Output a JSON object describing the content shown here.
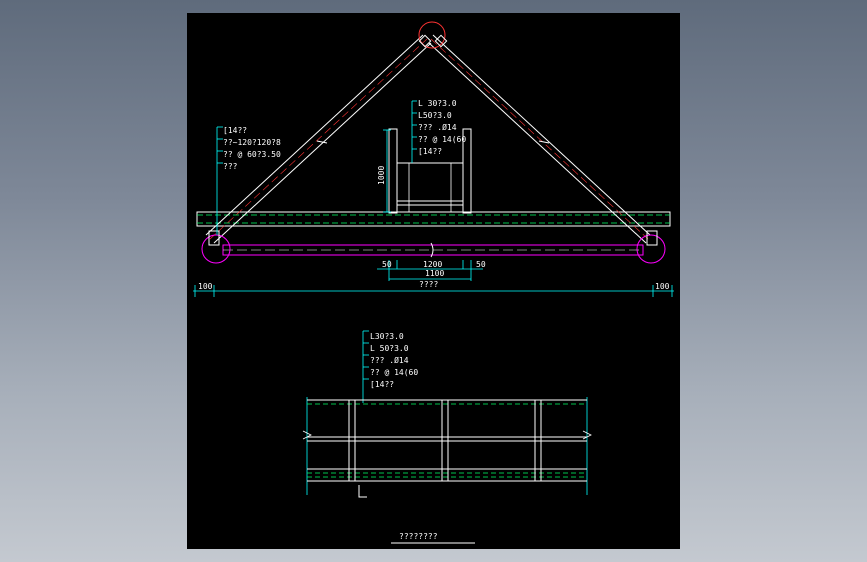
{
  "colors": {
    "background": "#000000",
    "frame": "#00ffff",
    "member": "#ffffff",
    "bracing": "#ff00ff",
    "detail": "#ff3333",
    "beam_edge": "#00ff66",
    "text": "#ffffff"
  },
  "elevation": {
    "left_callout": [
      "[14??",
      "??~120?120?8",
      "??  @ 60?3.50",
      "???"
    ],
    "center_callout": [
      "L  30?3.0",
      "L50?3.0",
      "???  .Ø14",
      "??  @ 14(60",
      "[14??"
    ],
    "height_dim": "1000",
    "dims_small": {
      "left": "50",
      "center": "1200",
      "right": "50",
      "total_inner": "1100"
    },
    "span_label": "????",
    "edge_left": "100",
    "edge_right": "100"
  },
  "plan": {
    "callout": [
      "L30?3.0",
      "L   50?3.0",
      "???  .Ø14",
      "??  @ 14(60",
      "[14??"
    ]
  },
  "drawing_title": "????????"
}
